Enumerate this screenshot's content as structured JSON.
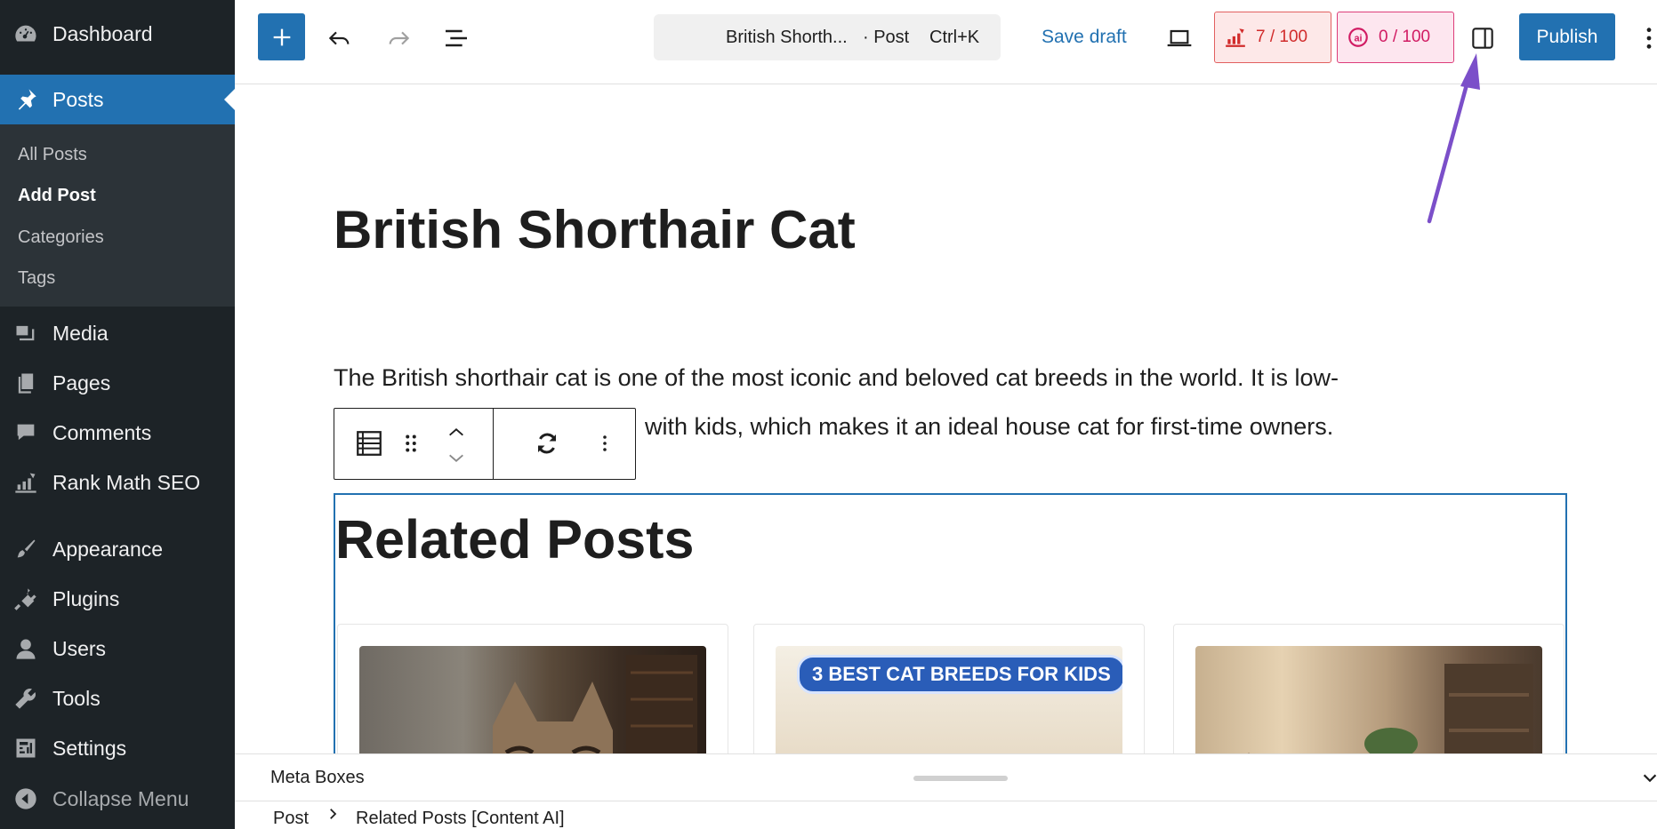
{
  "sidebar": {
    "dashboard": "Dashboard",
    "posts": "Posts",
    "sub": {
      "all_posts": "All Posts",
      "add_post": "Add Post",
      "categories": "Categories",
      "tags": "Tags"
    },
    "media": "Media",
    "pages": "Pages",
    "comments": "Comments",
    "rank_math": "Rank Math SEO",
    "appearance": "Appearance",
    "plugins": "Plugins",
    "users": "Users",
    "tools": "Tools",
    "settings": "Settings",
    "collapse": "Collapse Menu"
  },
  "toolbar": {
    "doc_title": "British Shorth...",
    "doc_type": "· Post",
    "shortcut": "Ctrl+K",
    "save_draft": "Save draft",
    "seo_score": "7 / 100",
    "ai_score": "0 / 100",
    "publish": "Publish"
  },
  "editor": {
    "title": "British Shorthair Cat",
    "paragraph_line1": "The British shorthair cat is one of the most iconic and beloved cat breeds in the world. It is low-",
    "paragraph_line2": "with kids, which makes it an ideal house cat for first-time owners.",
    "related_heading": "Related Posts",
    "card2_badge": "3 BEST CAT BREEDS FOR KIDS"
  },
  "bottom": {
    "meta_boxes": "Meta Boxes",
    "breadcrumb_post": "Post",
    "breadcrumb_block": "Related Posts [Content AI]"
  },
  "colors": {
    "wp_blue": "#2271b1",
    "sidebar_bg": "#1d2327",
    "annotation_arrow": "#7b4fc9",
    "seo_red": "#d12b2b",
    "ai_pink": "#d11b63"
  }
}
